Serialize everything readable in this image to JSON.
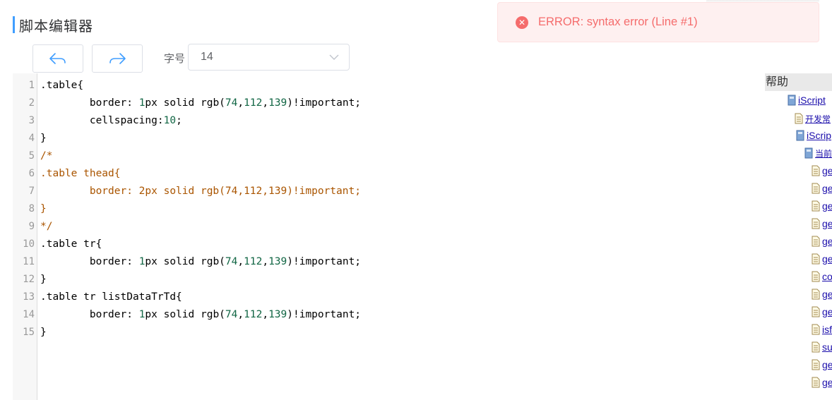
{
  "header": {
    "title": "脚本编辑器"
  },
  "toolbar": {
    "undo_icon": "undo-arrow-icon",
    "redo_icon": "redo-arrow-icon",
    "font_label": "字号",
    "font_size_value": "14"
  },
  "editor": {
    "line_numbers": [
      "1",
      "2",
      "3",
      "4",
      "5",
      "6",
      "7",
      "8",
      "9",
      "10",
      "11",
      "12",
      "13",
      "14",
      "15"
    ],
    "lines": [
      ".table{",
      "        border: 1px solid rgb(74,112,139)!important;",
      "        cellspacing:10;",
      "}",
      "/*",
      ".table thead{",
      "        border: 2px solid rgb(74,112,139)!important;",
      "}",
      "*/",
      ".table tr{",
      "        border: 1px solid rgb(74,112,139)!important;",
      "}",
      ".table tr listDataTrTd{",
      "        border: 1px solid rgb(74,112,139)!important;",
      "}"
    ]
  },
  "help": {
    "title": "帮助",
    "items": [
      {
        "label": "iScript",
        "icon": "book-icon"
      },
      {
        "label": "开发常",
        "icon": "page-icon"
      },
      {
        "label": "iScrip",
        "icon": "book-icon"
      },
      {
        "label": "当前",
        "icon": "book-icon"
      },
      {
        "label": "ge",
        "icon": "page-icon"
      },
      {
        "label": "ge",
        "icon": "page-icon"
      },
      {
        "label": "ge",
        "icon": "page-icon"
      },
      {
        "label": "ge",
        "icon": "page-icon"
      },
      {
        "label": "ge",
        "icon": "page-icon"
      },
      {
        "label": "ge",
        "icon": "page-icon"
      },
      {
        "label": "co",
        "icon": "page-icon"
      },
      {
        "label": "ge",
        "icon": "page-icon"
      },
      {
        "label": "ge",
        "icon": "page-icon"
      },
      {
        "label": "isf",
        "icon": "page-icon"
      },
      {
        "label": "su",
        "icon": "page-icon"
      },
      {
        "label": "ge",
        "icon": "page-icon"
      },
      {
        "label": "ge",
        "icon": "page-icon"
      }
    ]
  },
  "notification": {
    "message": "ERROR: syntax error (Line #1)",
    "icon": "error-icon",
    "color": "#f56c6c"
  },
  "colors": {
    "accent": "#409eff",
    "error": "#f56c6c",
    "number": "#116644",
    "comment": "#aa5500"
  }
}
